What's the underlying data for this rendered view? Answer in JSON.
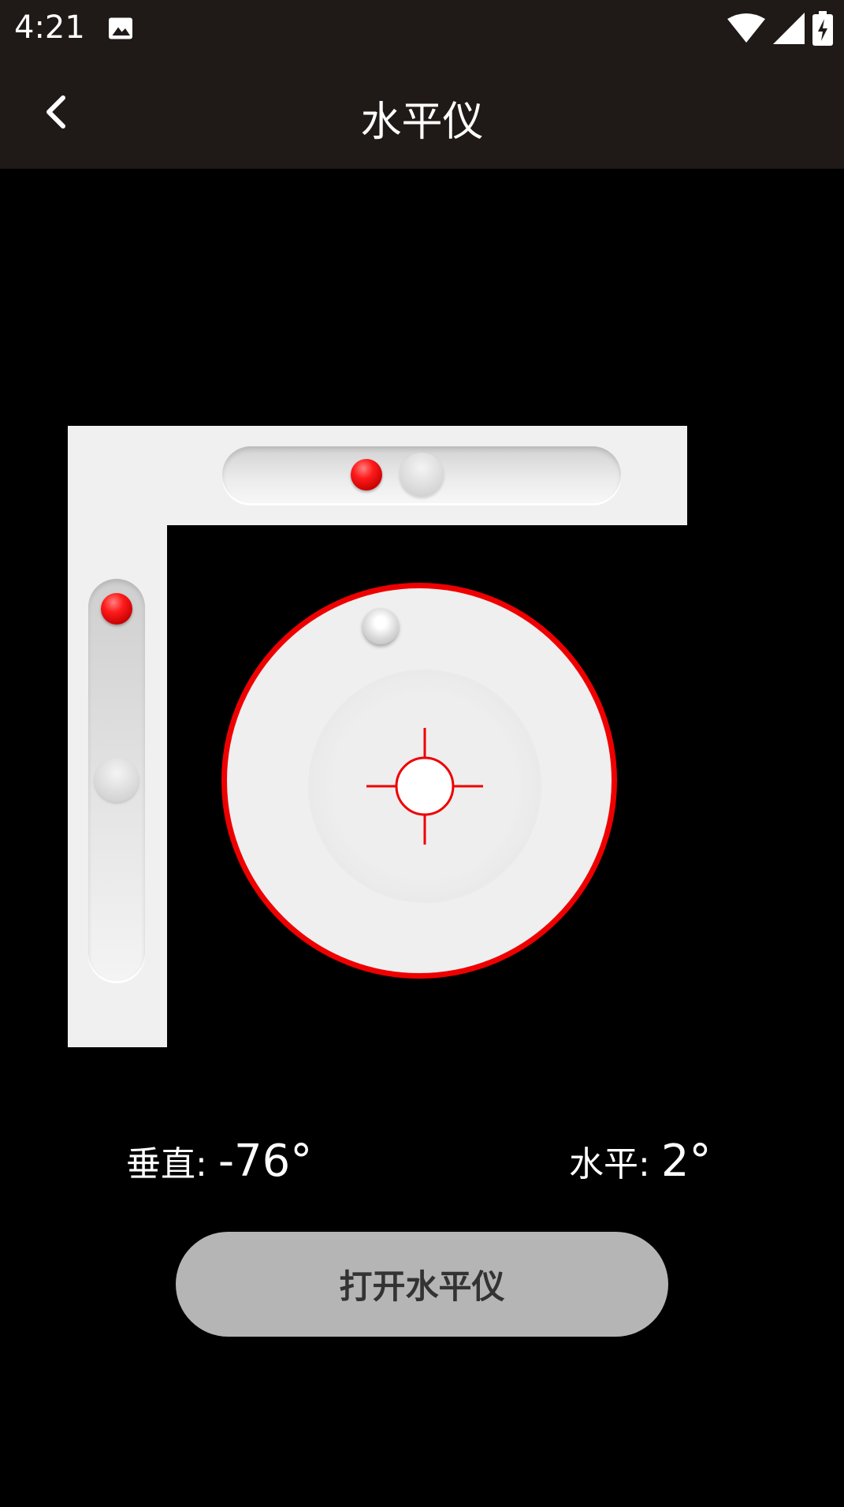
{
  "status_bar": {
    "time": "4:21",
    "icons": [
      "gallery-icon",
      "wifi-icon",
      "signal-icon",
      "battery-charging-icon"
    ]
  },
  "app_bar": {
    "title": "水平仪",
    "back_icon": "chevron-left-icon"
  },
  "level": {
    "horizontal_tube_icon": "horizontal-bubble-tube",
    "vertical_tube_icon": "vertical-bubble-tube",
    "circle_icon": "bullseye-level",
    "accent_color": "#ee0000",
    "frame_color": "#f0f0f0"
  },
  "readouts": {
    "vertical_label": "垂直:",
    "vertical_value": "-76°",
    "horizontal_label": "水平:",
    "horizontal_value": "2°"
  },
  "button": {
    "open_label": "打开水平仪"
  }
}
